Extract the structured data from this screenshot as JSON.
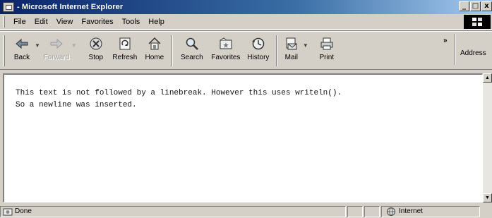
{
  "window": {
    "title": "- Microsoft Internet Explorer",
    "controls": {
      "minimize": "_",
      "maximize": "□",
      "close": "x"
    }
  },
  "menu": {
    "items": [
      {
        "label": "File"
      },
      {
        "label": "Edit"
      },
      {
        "label": "View"
      },
      {
        "label": "Favorites"
      },
      {
        "label": "Tools"
      },
      {
        "label": "Help"
      }
    ]
  },
  "toolbar": {
    "buttons": [
      {
        "label": "Back",
        "icon": "back-arrow-icon",
        "enabled": true
      },
      {
        "label": "Forward",
        "icon": "forward-arrow-icon",
        "enabled": false
      },
      {
        "label": "Stop",
        "icon": "stop-icon",
        "enabled": true
      },
      {
        "label": "Refresh",
        "icon": "refresh-icon",
        "enabled": true
      },
      {
        "label": "Home",
        "icon": "home-icon",
        "enabled": true
      },
      {
        "label": "Search",
        "icon": "search-icon",
        "enabled": true
      },
      {
        "label": "Favorites",
        "icon": "favorites-icon",
        "enabled": true
      },
      {
        "label": "History",
        "icon": "history-icon",
        "enabled": true
      },
      {
        "label": "Mail",
        "icon": "mail-icon",
        "enabled": true
      },
      {
        "label": "Print",
        "icon": "print-icon",
        "enabled": true
      }
    ],
    "address_label": "Address",
    "more_glyph": "»"
  },
  "page": {
    "lines": [
      "This text is not followed by a linebreak. However this uses writeln().",
      "So a newline was inserted."
    ]
  },
  "status": {
    "text": "Done",
    "zone": "Internet"
  },
  "colors": {
    "chrome": "#d4d0c8",
    "title_start": "#0a246a",
    "title_end": "#a6caf0"
  }
}
